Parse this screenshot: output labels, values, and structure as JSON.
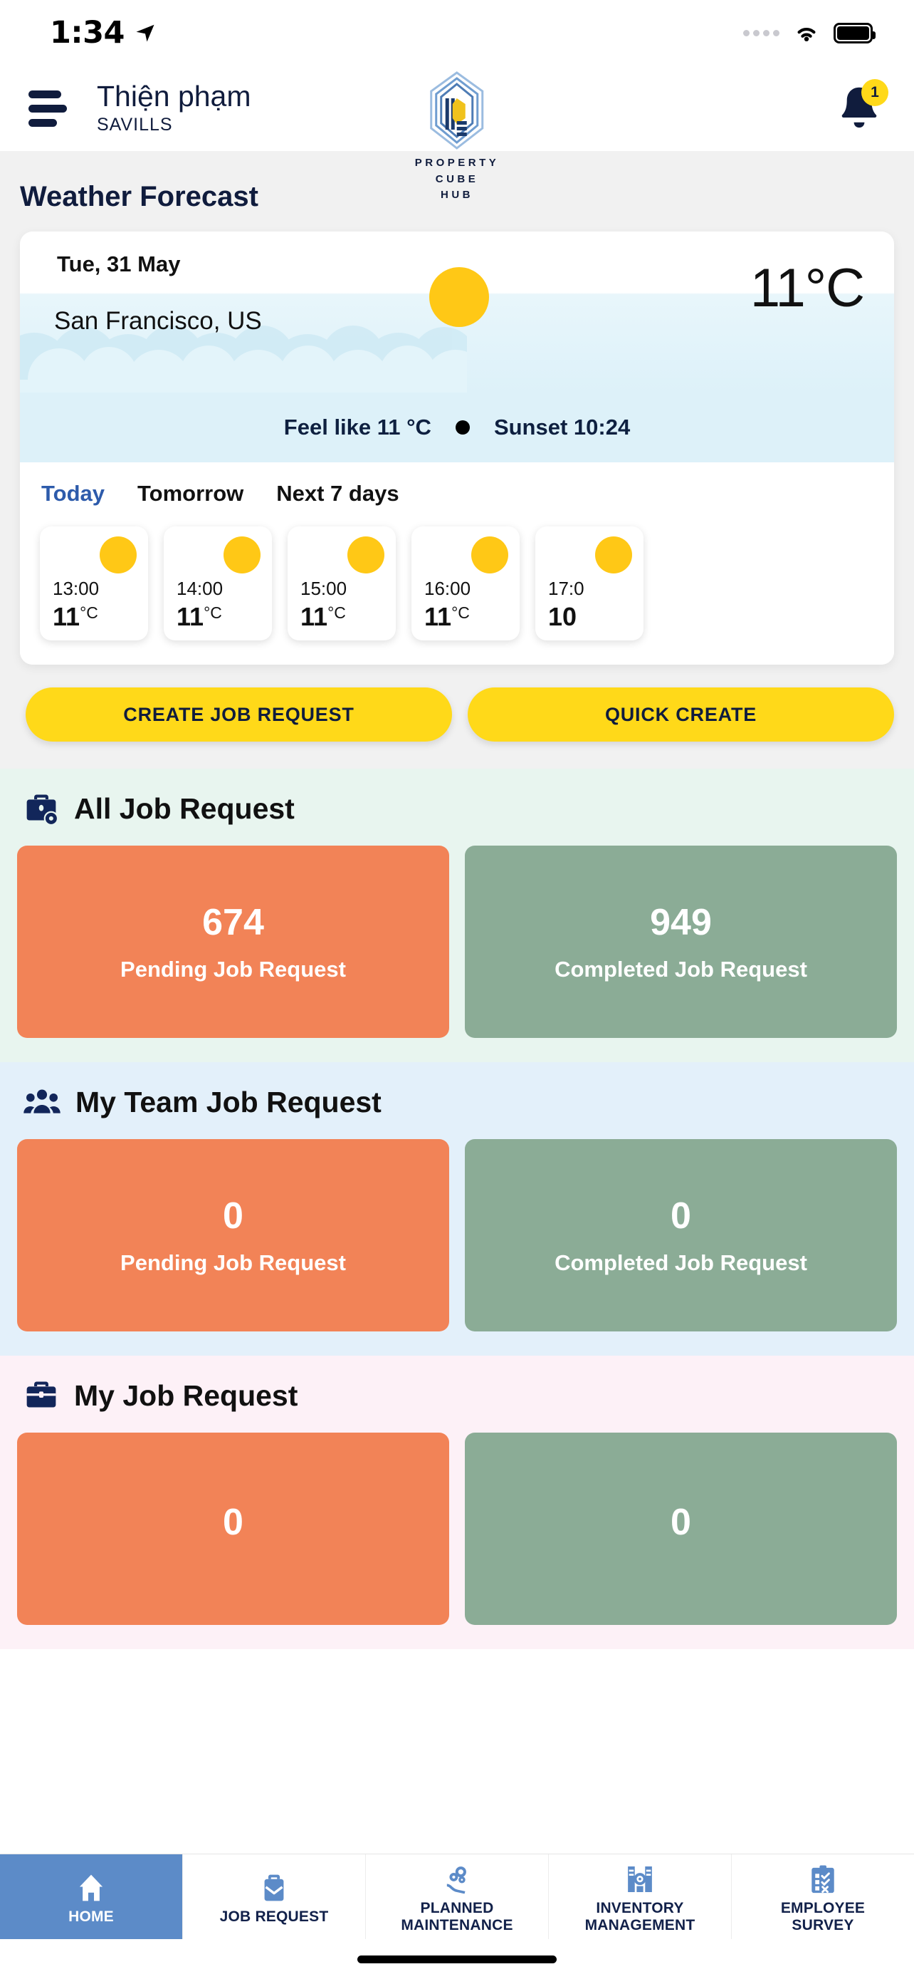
{
  "status_bar": {
    "time": "1:34",
    "location_icon": "location-arrow-icon",
    "wifi_icon": "wifi-icon",
    "battery_icon": "battery-full-icon"
  },
  "header": {
    "menu_icon": "hamburger-menu-icon",
    "user_name": "Thiện phạm",
    "company": "SAVILLS",
    "logo_line1": "PROPERTY",
    "logo_line2": "CUBE",
    "logo_line3": "HUB",
    "notification_icon": "bell-icon",
    "notification_count": "1"
  },
  "weather": {
    "section_title": "Weather Forecast",
    "date": "Tue, 31 May",
    "city": "San Francisco, US",
    "temperature": "11°C",
    "weather_icon": "sun-icon",
    "feels_like": "Feel like 11 °C",
    "sunset": "Sunset 10:24",
    "tabs": [
      {
        "label": "Today",
        "active": true
      },
      {
        "label": "Tomorrow",
        "active": false
      },
      {
        "label": "Next 7 days",
        "active": false
      }
    ],
    "hourly": [
      {
        "time": "13:00",
        "temp": "11",
        "unit": "°C",
        "icon": "sun-icon"
      },
      {
        "time": "14:00",
        "temp": "11",
        "unit": "°C",
        "icon": "sun-icon"
      },
      {
        "time": "15:00",
        "temp": "11",
        "unit": "°C",
        "icon": "sun-icon"
      },
      {
        "time": "16:00",
        "temp": "11",
        "unit": "°C",
        "icon": "sun-icon"
      },
      {
        "time": "17:0",
        "temp": "10",
        "unit": "",
        "icon": "sun-icon"
      }
    ]
  },
  "actions": {
    "create_job_request": "CREATE JOB REQUEST",
    "quick_create": "QUICK CREATE"
  },
  "job_sections": [
    {
      "icon": "briefcase-gear-icon",
      "title": "All Job Request",
      "pending_count": "674",
      "pending_label": "Pending Job Request",
      "completed_count": "949",
      "completed_label": "Completed Job Request"
    },
    {
      "icon": "team-people-icon",
      "title": "My Team Job Request",
      "pending_count": "0",
      "pending_label": "Pending Job Request",
      "completed_count": "0",
      "completed_label": "Completed Job Request"
    },
    {
      "icon": "briefcase-icon",
      "title": "My Job Request",
      "pending_count": "0",
      "pending_label": "",
      "completed_count": "0",
      "completed_label": ""
    }
  ],
  "bottom_nav": [
    {
      "icon": "home-icon",
      "label": "HOME",
      "active": true
    },
    {
      "icon": "briefcase-mail-icon",
      "label": "JOB REQUEST",
      "active": false
    },
    {
      "icon": "hand-gears-icon",
      "label": "PLANNED\nMAINTENANCE",
      "line1": "PLANNED",
      "line2": "MAINTENANCE",
      "active": false
    },
    {
      "icon": "warehouse-icon",
      "label": "INVENTORY\nMANAGEMENT",
      "line1": "INVENTORY",
      "line2": "MANAGEMENT",
      "active": false
    },
    {
      "icon": "clipboard-check-icon",
      "label": "EMPLOYEE\nSURVEY",
      "line1": "EMPLOYEE",
      "line2": "SURVEY",
      "active": false
    }
  ],
  "colors": {
    "brand_navy": "#101c3d",
    "accent_yellow": "#ffd919",
    "sun_yellow": "#ffc816",
    "pending_orange": "#f28357",
    "completed_green": "#8bac96",
    "nav_active_blue": "#5c8bc8",
    "tab_active_blue": "#2d5bab"
  }
}
